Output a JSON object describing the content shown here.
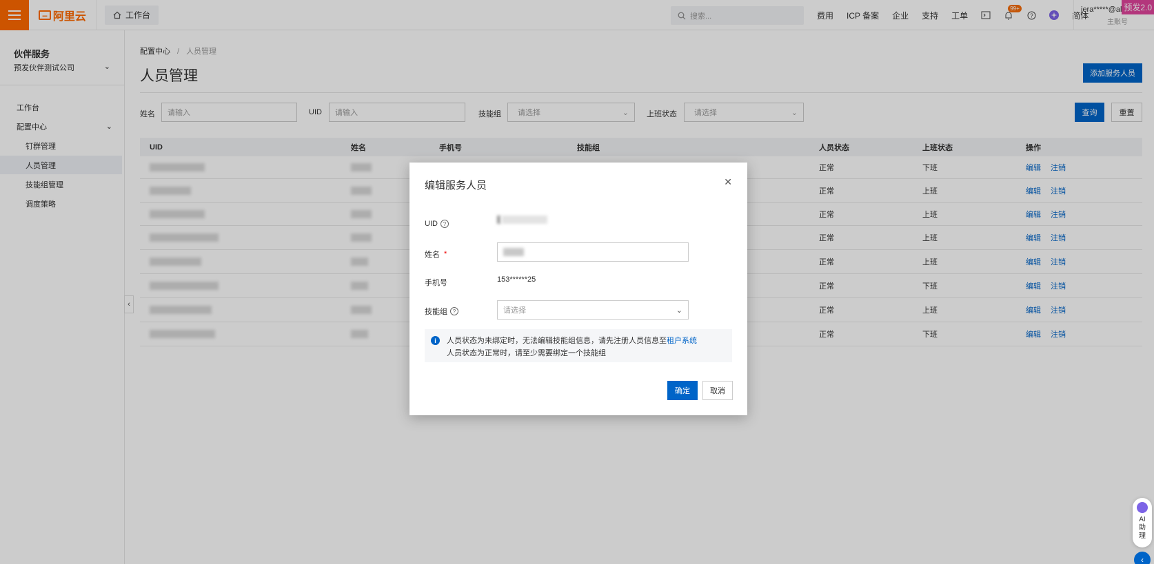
{
  "topbar": {
    "logo_text": "阿里云",
    "workbench_label": "工作台",
    "search_placeholder": "搜索...",
    "links": [
      "费用",
      "ICP 备案",
      "企业",
      "支持",
      "工单"
    ],
    "notification_badge": "99+",
    "language": "简体",
    "user_name": "jera*****@al...",
    "user_role": "主账号",
    "prerelease_tag": "预发2.0"
  },
  "sidebar": {
    "title": "伙伴服务",
    "company": "预发伙伴测试公司",
    "items": [
      {
        "label": "工作台"
      },
      {
        "label": "配置中心"
      },
      {
        "label": "钉群管理"
      },
      {
        "label": "人员管理"
      },
      {
        "label": "技能组管理"
      },
      {
        "label": "调度策略"
      }
    ]
  },
  "page": {
    "breadcrumb_root": "配置中心",
    "breadcrumb_sep": "/",
    "breadcrumb_current": "人员管理",
    "title": "人员管理",
    "add_button": "添加服务人员"
  },
  "filters": {
    "name_label": "姓名",
    "name_placeholder": "请输入",
    "uid_label": "UID",
    "uid_placeholder": "请输入",
    "skill_label": "技能组",
    "skill_placeholder": "请选择",
    "work_label": "上班状态",
    "work_placeholder": "请选择",
    "query_button": "查询",
    "reset_button": "重置"
  },
  "table": {
    "headers": [
      "UID",
      "姓名",
      "手机号",
      "技能组",
      "人员状态",
      "上班状态",
      "操作"
    ],
    "edit_label": "编辑",
    "cancel_label": "注销",
    "rows": [
      {
        "status": "正常",
        "work": "下班"
      },
      {
        "status": "正常",
        "work": "上班"
      },
      {
        "status": "正常",
        "work": "上班"
      },
      {
        "status": "正常",
        "work": "上班"
      },
      {
        "status": "正常",
        "work": "上班"
      },
      {
        "status": "正常",
        "work": "下班"
      },
      {
        "status": "正常",
        "work": "上班"
      },
      {
        "status": "正常",
        "work": "下班"
      }
    ]
  },
  "modal": {
    "title": "编辑服务人员",
    "uid_label": "UID",
    "name_label": "姓名",
    "phone_label": "手机号",
    "phone_value": "153******25",
    "skill_label": "技能组",
    "skill_placeholder": "请选择",
    "notice_line1": "人员状态为未绑定时，无法编辑技能组信息，请先注册人员信息至",
    "notice_link": "租户系统",
    "notice_line2": "人员状态为正常时，请至少需要绑定一个技能组",
    "ok_button": "确定",
    "cancel_button": "取消"
  },
  "ai_assistant": {
    "label_1": "AI",
    "label_2": "助",
    "label_3": "理"
  },
  "colors": {
    "brand_orange": "#ff6a00",
    "primary_blue": "#0064c8",
    "prerelease_pink": "#e0449b"
  }
}
